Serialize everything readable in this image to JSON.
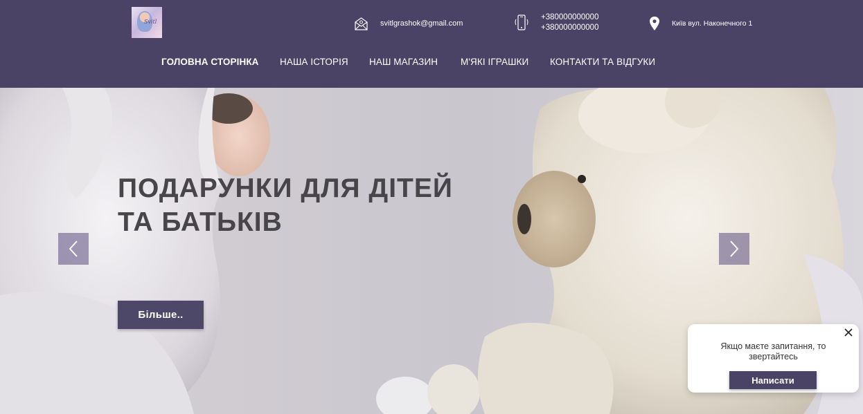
{
  "colors": {
    "header_bg": "#4a4365",
    "accent": "#4e4868",
    "title_text": "#474547",
    "white": "#ffffff"
  },
  "header": {
    "logo_text": "Svitl",
    "email": "svitlgrashok@gmail.com",
    "phones": [
      "+380000000000",
      "+380000000000"
    ],
    "address": "Київ вул. Наконечного 1"
  },
  "nav": {
    "items": [
      {
        "label": "ГОЛОВНА СТОРІНКА",
        "active": true
      },
      {
        "label": "НАША ІСТОРІЯ",
        "active": false
      },
      {
        "label": "НАШ МАГАЗИН",
        "active": false
      },
      {
        "label": "М'ЯКІ ІГРАШКИ",
        "active": false
      },
      {
        "label": "КОНТАКТИ ТА ВІДГУКИ",
        "active": false
      }
    ]
  },
  "hero": {
    "title_line1": "ПОДАРУНКИ ДЛЯ ДІТЕЙ",
    "title_line2": "ТА БАТЬКІВ",
    "button_label": "Більше.."
  },
  "chat": {
    "message": "Якщо маєте запитання, то звертайтесь",
    "button_label": "Написати"
  },
  "icons": {
    "email": "envelope-icon",
    "phone": "phone-icon",
    "location": "map-pin-icon",
    "prev": "chevron-left-icon",
    "next": "chevron-right-icon",
    "close": "close-icon"
  }
}
